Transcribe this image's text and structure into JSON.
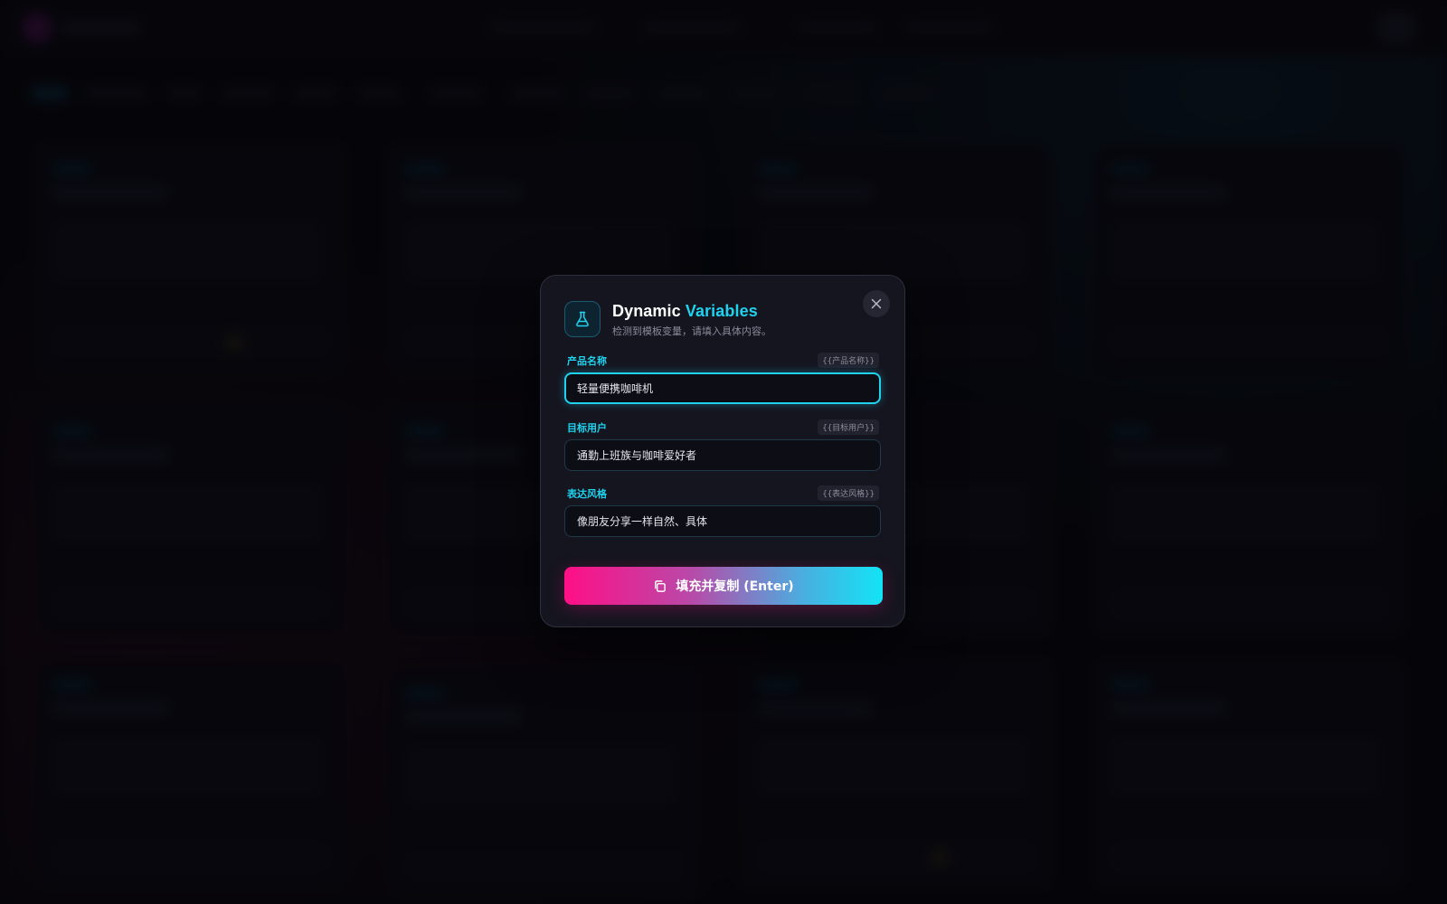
{
  "modal": {
    "title_main": "Dynamic",
    "title_accent": "Variables",
    "subtitle": "检测到模板变量，请填入具体内容。",
    "icon": "flask-icon",
    "close_icon": "close-icon"
  },
  "fields": [
    {
      "label": "产品名称",
      "tag": "{{产品名称}}",
      "value": "轻量便携咖啡机",
      "focused": true
    },
    {
      "label": "目标用户",
      "tag": "{{目标用户}}",
      "value": "通勤上班族与咖啡爱好者",
      "focused": false
    },
    {
      "label": "表达风格",
      "tag": "{{表达风格}}",
      "value": "像朋友分享一样自然、具体",
      "focused": false
    }
  ],
  "submit": {
    "label": "填充并复制 (Enter)",
    "icon": "copy-icon"
  },
  "colors": {
    "accent": "#1fd2ee",
    "gradient_start": "#ff0f86",
    "gradient_end": "#13e3f5",
    "modal_bg": "#15151f"
  }
}
